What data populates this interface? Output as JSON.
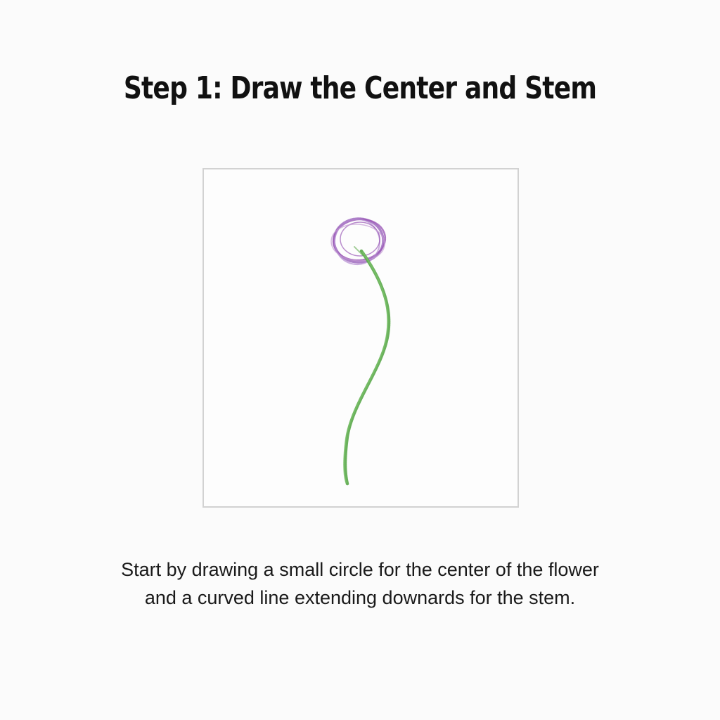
{
  "title": "Step 1: Draw the Center and Stem",
  "caption": {
    "line1": "Start by drawing a small circle for the center of the flower",
    "line2": "and a curved line extending downards for the stem."
  },
  "illustration": {
    "flower_center_color": "#9b59b6",
    "stem_color": "#5aa84a",
    "frame_color": "#d2d2d2"
  }
}
